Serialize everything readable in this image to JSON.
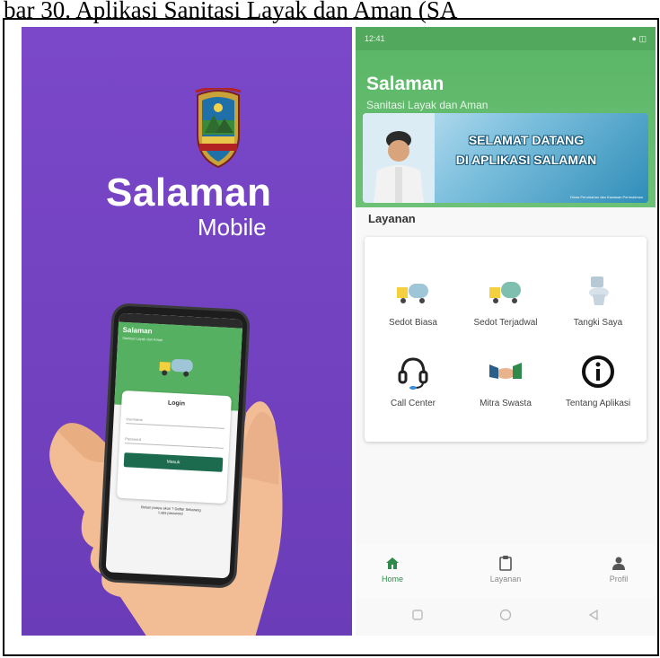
{
  "caption": "bar 30. Aplikasi Sanitasi Layak dan Aman (SA",
  "splash": {
    "title": "Salaman",
    "subtitle": "Mobile",
    "phone": {
      "app_title": "Salaman",
      "app_subtitle": "Sanitasi Layak dan Aman",
      "login_title": "Login",
      "username_placeholder": "Username",
      "password_placeholder": "Password",
      "login_button": "Masuk",
      "register_text": "Belum punya akun ? Daftar Sekarang",
      "forgot_text": "Lupa password"
    }
  },
  "home": {
    "status_time": "12:41",
    "status_right": "● ◫",
    "app_title": "Salaman",
    "app_subtitle": "Sanitasi Layak dan Aman",
    "banner_line1": "SELAMAT DATANG",
    "banner_line2": "DI APLIKASI SALAMAN",
    "banner_footer": "Dinas Perumahan dan Kawasan Permukiman",
    "section_label": "Layanan",
    "services": [
      {
        "label": "Sedot Biasa",
        "icon": "truck-icon"
      },
      {
        "label": "Sedot Terjadwal",
        "icon": "tanker-icon"
      },
      {
        "label": "Tangki Saya",
        "icon": "toilet-icon"
      },
      {
        "label": "Call Center",
        "icon": "headset-icon"
      },
      {
        "label": "Mitra Swasta",
        "icon": "handshake-icon"
      },
      {
        "label": "Tentang Aplikasi",
        "icon": "info-icon"
      }
    ],
    "nav": [
      {
        "label": "Home",
        "icon": "home-icon"
      },
      {
        "label": "Layanan",
        "icon": "clipboard-icon"
      },
      {
        "label": "Profil",
        "icon": "person-icon"
      }
    ],
    "colors": {
      "primary_green": "#56b061",
      "dark_green": "#1c6b4f",
      "purple": "#6b3cb8"
    }
  }
}
